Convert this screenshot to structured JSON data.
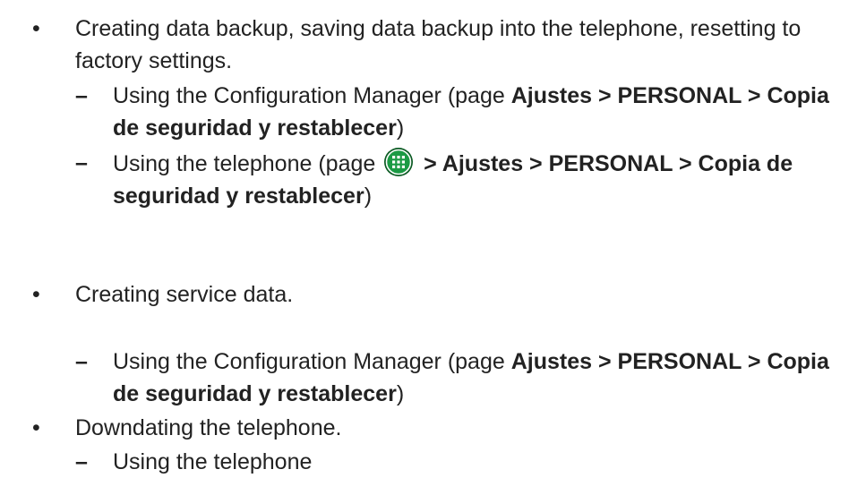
{
  "items": [
    {
      "text": "Creating data backup, saving data backup into the telephone, resetting to factory settings.",
      "subitems": [
        {
          "prefix": "Using the Configuration Manager (page ",
          "bold": "Ajustes > PERSONAL > Copia de seguridad y restablecer",
          "suffix": ")"
        },
        {
          "prefix": "Using the telephone (page ",
          "icon": "apps-grid-icon",
          "bold": " > Ajustes > PERSONAL > Copia de seguridad y restablecer",
          "suffix": ")"
        }
      ]
    },
    {
      "text": "Creating service data.",
      "subitems": [
        {
          "prefix": "Using the Configuration Manager (page ",
          "bold": "Ajustes > PERSONAL > Copia de seguridad y restablecer",
          "suffix": ")"
        }
      ]
    },
    {
      "text": "Downdating the telephone.",
      "subitems": [
        {
          "text": "Using the telephone"
        }
      ]
    }
  ],
  "glyphs": {
    "bullet": "•",
    "dash": "–"
  },
  "colors": {
    "text": "#222222",
    "icon_fill": "#0a7a2e",
    "icon_ring": "#0a5a22"
  }
}
